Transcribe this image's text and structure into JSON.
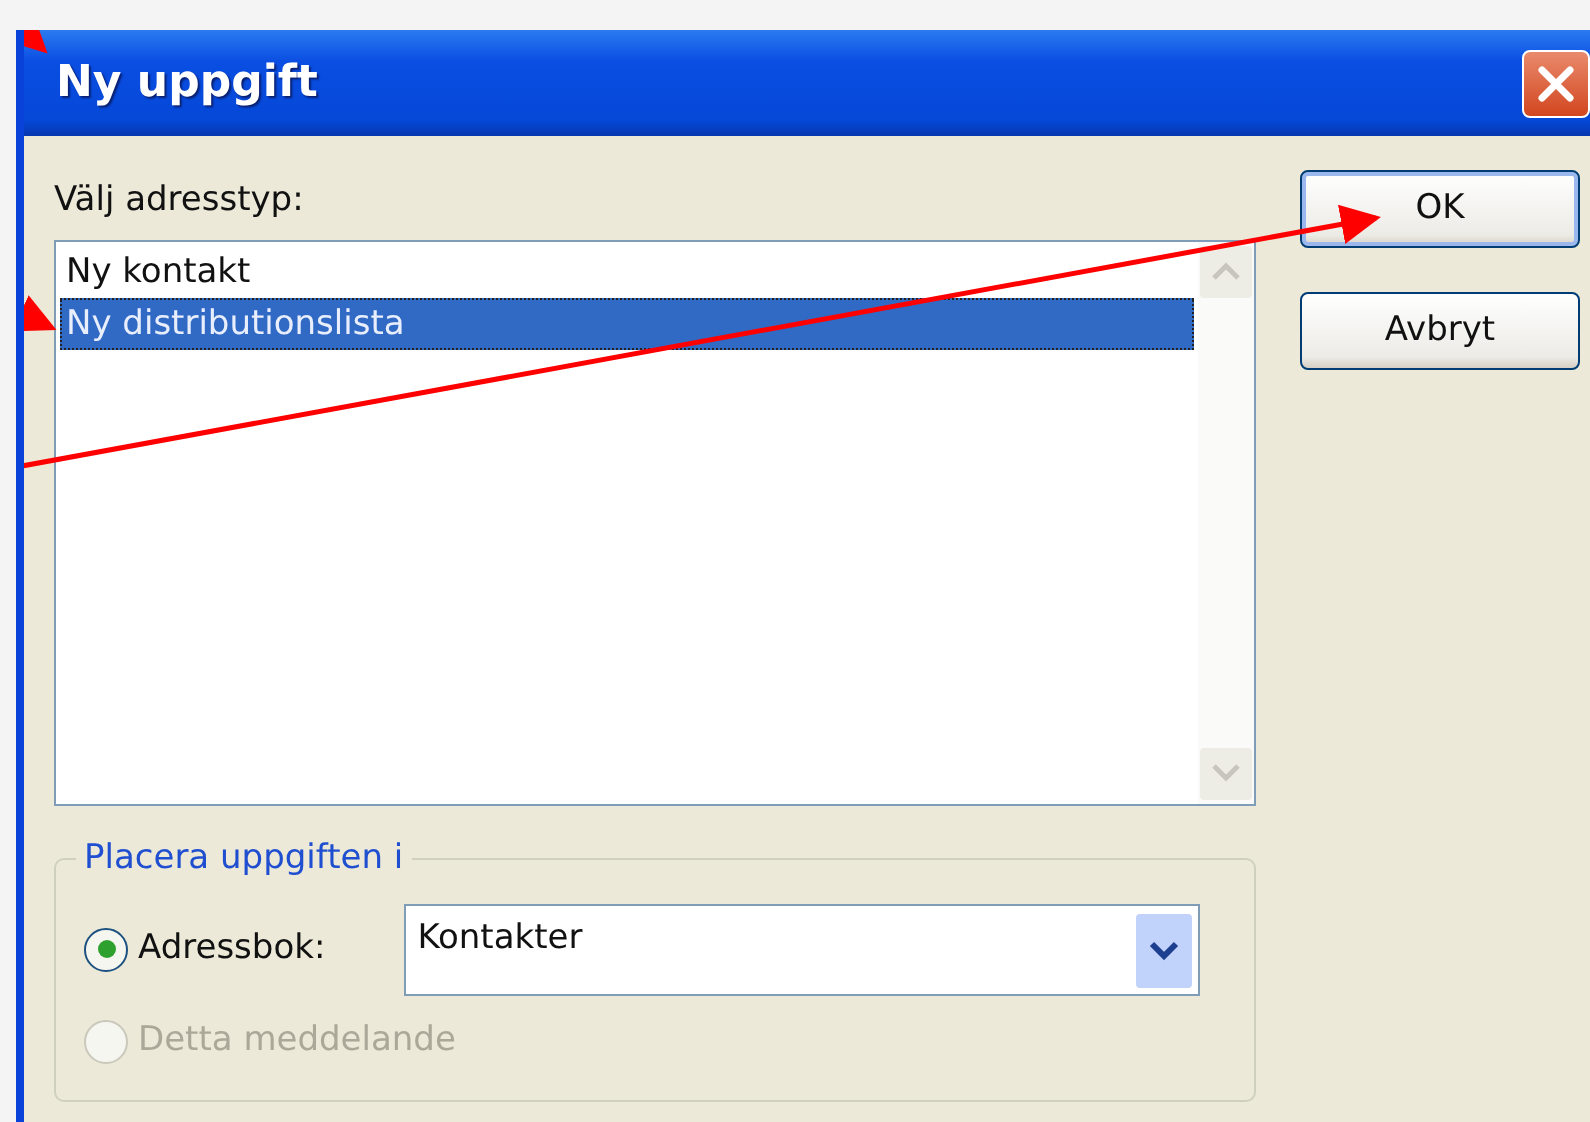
{
  "window": {
    "title": "Ny uppgift"
  },
  "list": {
    "label": "Välj adresstyp:",
    "items": [
      {
        "text": "Ny kontakt",
        "selected": false
      },
      {
        "text": "Ny distributionslista",
        "selected": true
      }
    ]
  },
  "buttons": [
    {
      "label": "OK",
      "default": true
    },
    {
      "label": "Avbryt",
      "default": false
    }
  ],
  "placement": {
    "legend": "Placera uppgiften i",
    "options": [
      {
        "label": "Adressbok:",
        "selected": true,
        "disabled": false
      },
      {
        "label": "Detta meddelande",
        "selected": false,
        "disabled": true
      }
    ],
    "combo": {
      "value": "Kontakter"
    }
  }
}
